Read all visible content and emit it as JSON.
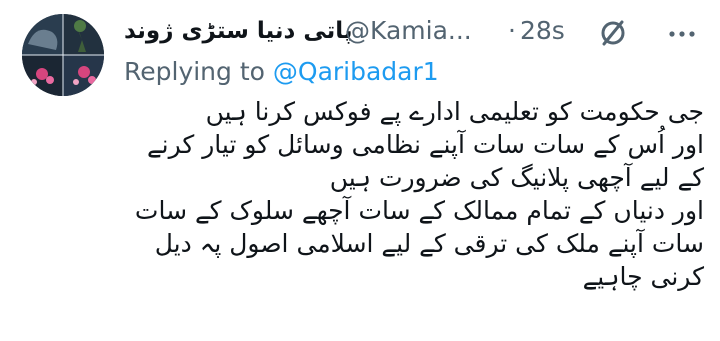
{
  "tweet": {
    "display_name": "پاتی دنیا ستڑی ژوند",
    "handle": "@Kamia...",
    "separator": "·",
    "time": "28s",
    "replying_prefix": "Replying to ",
    "replying_to": "@Qaribadar1",
    "lines": [
      "جی حکومت کو تعلیمی ادارے پے فوکس کرنا ہیں",
      "اور اُس کے سات سات آپنے نظامی وسائل کو تیار کرنے",
      "کے لیے آچھی پلانیگ کی ضرورت ہیں",
      "اور دنیاں کے تمام ممالک کے سات آچھے سلوک کے سات",
      "سات آپنے ملک کی ترقی کے لیے اسلامی اصول پہ دیل",
      "کرنی چاہیے"
    ]
  },
  "icons": {
    "header_action": "slash-circle-icon",
    "menu": "more-icon"
  },
  "colors": {
    "text": "#0f1419",
    "secondary": "#536471",
    "link": "#1d9bf0"
  }
}
